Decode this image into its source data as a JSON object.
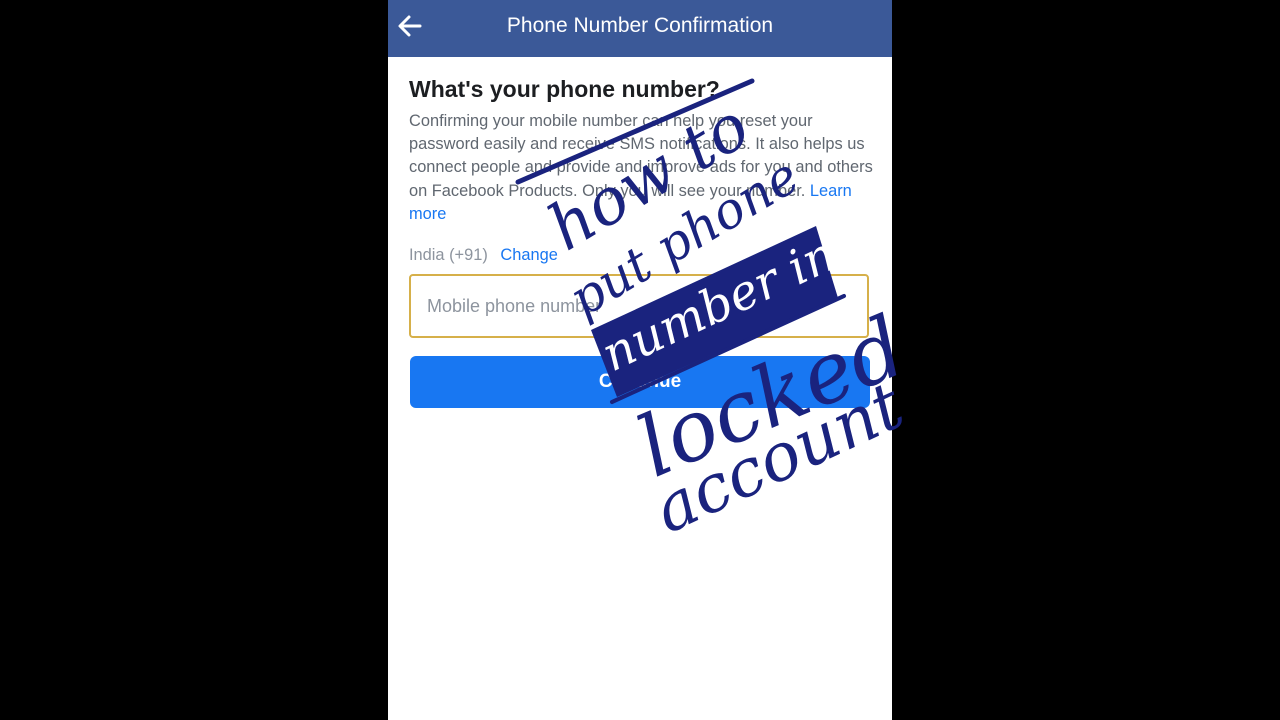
{
  "header": {
    "title": "Phone Number Confirmation",
    "back_icon": "arrow-left-icon"
  },
  "content": {
    "heading": "What's your phone number?",
    "description": "Confirming your mobile number can help you reset your password easily and receive SMS notifications. It also helps us connect people and provide and improve ads for you and others on Facebook Products. Only you will see your number.",
    "learn_more": "Learn more",
    "country": "India (+91)",
    "change_label": "Change",
    "phone_placeholder": "Mobile phone number",
    "continue_label": "Continue"
  },
  "overlay": {
    "lines": [
      "how to",
      "put phone",
      "number in",
      "locked",
      "account"
    ],
    "color": "#1a237e"
  },
  "colors": {
    "header_bg": "#3b5998",
    "accent": "#1877f2",
    "input_border": "#d6b04a",
    "background": "#000000"
  }
}
